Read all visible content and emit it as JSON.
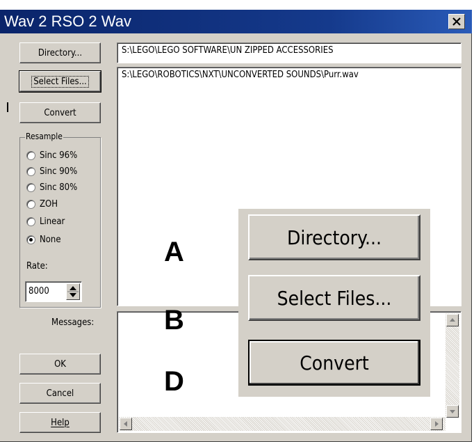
{
  "window": {
    "title": "Wav 2 RSO 2 Wav",
    "close_icon": "close-icon"
  },
  "buttons": {
    "directory": "Directory...",
    "select_files": "Select Files...",
    "convert": "Convert",
    "ok": "OK",
    "cancel": "Cancel",
    "help": "Help"
  },
  "directory_path": "S:\\LEGO\\LEGO SOFTWARE\\UN ZIPPED ACCESSORIES",
  "files": [
    "S:\\LEGO\\ROBOTICS\\NXT\\UNCONVERTED SOUNDS\\Purr.wav"
  ],
  "resample": {
    "legend": "Resample",
    "options": [
      "Sinc 96%",
      "Sinc 90%",
      "Sinc 80%",
      "ZOH",
      "Linear",
      "None"
    ],
    "selected": "None"
  },
  "rate": {
    "label": "Rate:",
    "value": "8000"
  },
  "messages_label": "Messages:",
  "zoom_inset": {
    "directory": "Directory...",
    "select_files": "Select Files...",
    "convert": "Convert"
  },
  "markers": {
    "a": "A",
    "b": "B",
    "d": "D"
  }
}
